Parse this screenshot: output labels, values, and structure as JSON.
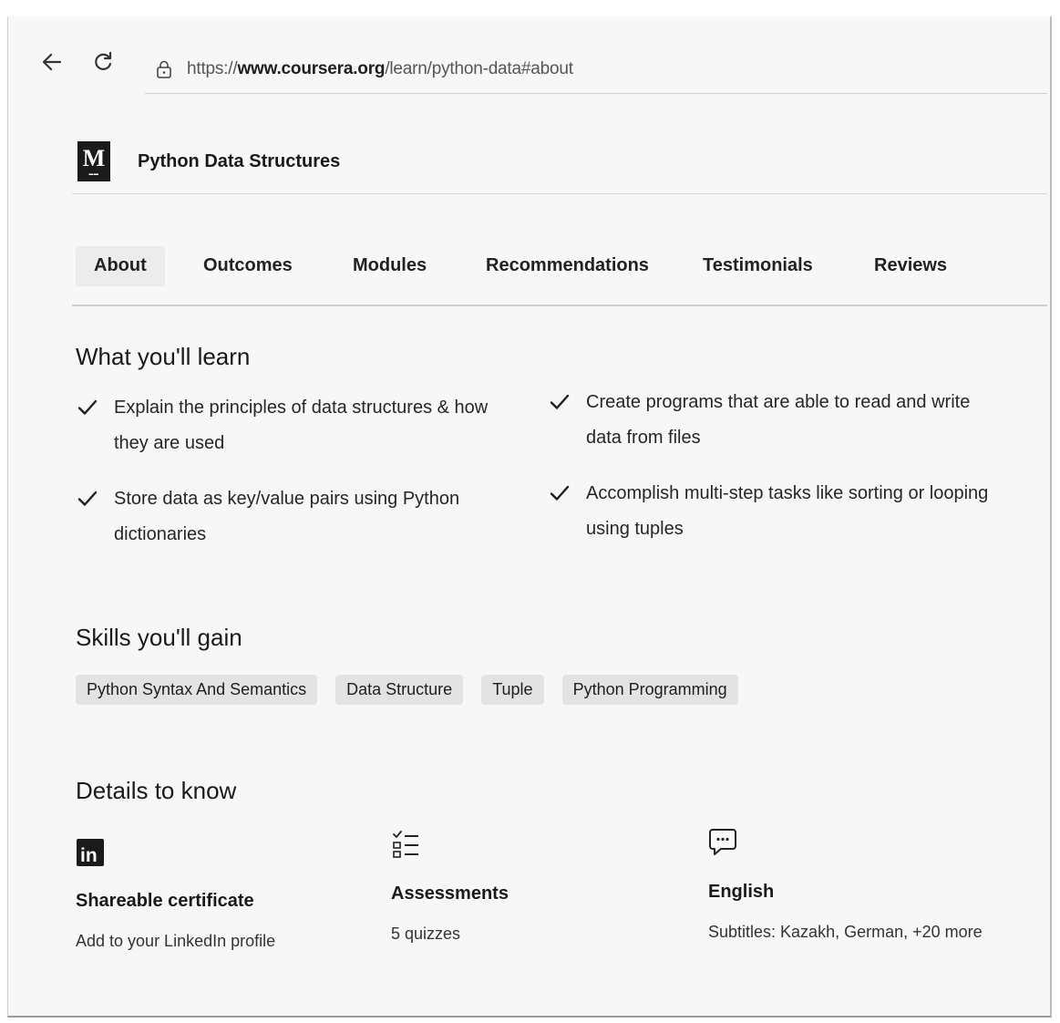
{
  "browser": {
    "url_scheme": "https://",
    "url_host": "www.coursera.org",
    "url_path": "/learn/python-data#about"
  },
  "course": {
    "logo_letter": "M",
    "title": "Python Data Structures"
  },
  "tabs": [
    {
      "label": "About",
      "active": true
    },
    {
      "label": "Outcomes",
      "active": false
    },
    {
      "label": "Modules",
      "active": false
    },
    {
      "label": "Recommendations",
      "active": false
    },
    {
      "label": "Testimonials",
      "active": false
    },
    {
      "label": "Reviews",
      "active": false
    }
  ],
  "learn": {
    "title": "What you'll learn",
    "items": [
      "Explain the principles of data structures & how they are used",
      "Create programs that are able to read and write data from files",
      "Store data as key/value pairs using Python dictionaries",
      "Accomplish multi-step tasks like sorting or looping using tuples"
    ]
  },
  "skills": {
    "title": "Skills you'll gain",
    "items": [
      "Python Syntax And Semantics",
      "Data Structure",
      "Tuple",
      "Python Programming"
    ]
  },
  "details": {
    "title": "Details to know",
    "items": [
      {
        "icon": "linkedin-icon",
        "title": "Shareable certificate",
        "subtitle": "Add to your LinkedIn profile"
      },
      {
        "icon": "checklist-icon",
        "title": "Assessments",
        "subtitle": "5 quizzes"
      },
      {
        "icon": "chat-bubble-icon",
        "title": "English",
        "subtitle": "Subtitles: Kazakh, German, +20 more"
      }
    ]
  }
}
